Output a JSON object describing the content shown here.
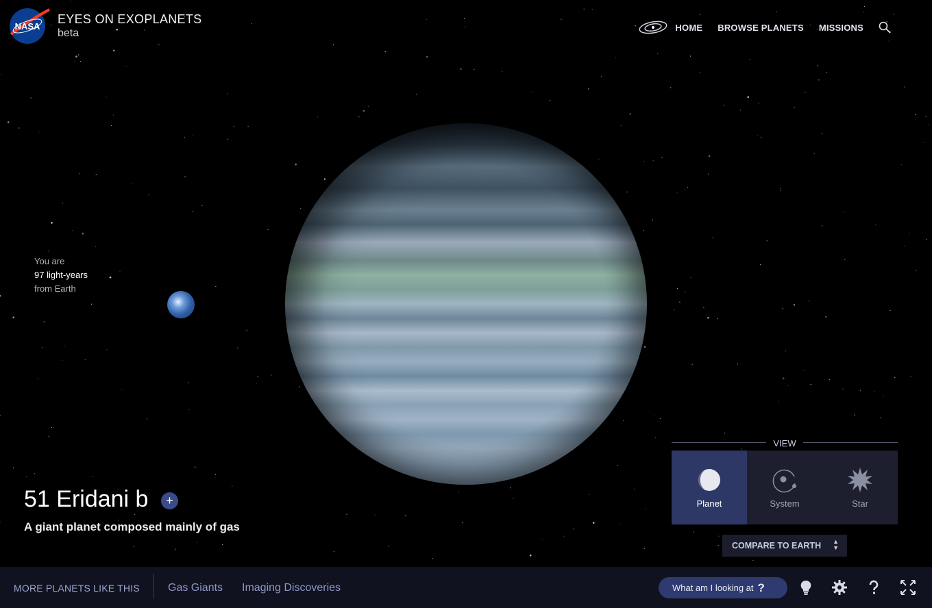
{
  "header": {
    "logo_text": "NASA",
    "title": "EYES ON EXOPLANETS",
    "subtitle": "beta",
    "nav": [
      "HOME",
      "BROWSE PLANETS",
      "MISSIONS"
    ]
  },
  "distance": {
    "prefix": "You are",
    "value": "97 light-years",
    "suffix": "from Earth"
  },
  "planet": {
    "name": "51 Eridani b",
    "add_symbol": "+",
    "description": "A giant planet composed mainly of gas"
  },
  "view": {
    "label": "VIEW",
    "options": [
      "Planet",
      "System",
      "Star"
    ],
    "active": "Planet"
  },
  "compare": {
    "label": "COMPARE TO EARTH"
  },
  "bottom_bar": {
    "more_label": "MORE PLANETS LIKE THIS",
    "links": [
      "Gas Giants",
      "Imaging Discoveries"
    ],
    "what_button": "What am I looking at",
    "what_button_symbol": "?"
  },
  "icons": [
    "nasa-logo",
    "galaxy-icon",
    "search-icon",
    "planet-view-icon",
    "system-view-icon",
    "star-view-icon",
    "lightbulb-icon",
    "gear-icon",
    "help-icon",
    "fullscreen-icon"
  ],
  "colors": {
    "accent": "#2e3866",
    "bar": "#10121f",
    "link": "#8e96c8"
  }
}
